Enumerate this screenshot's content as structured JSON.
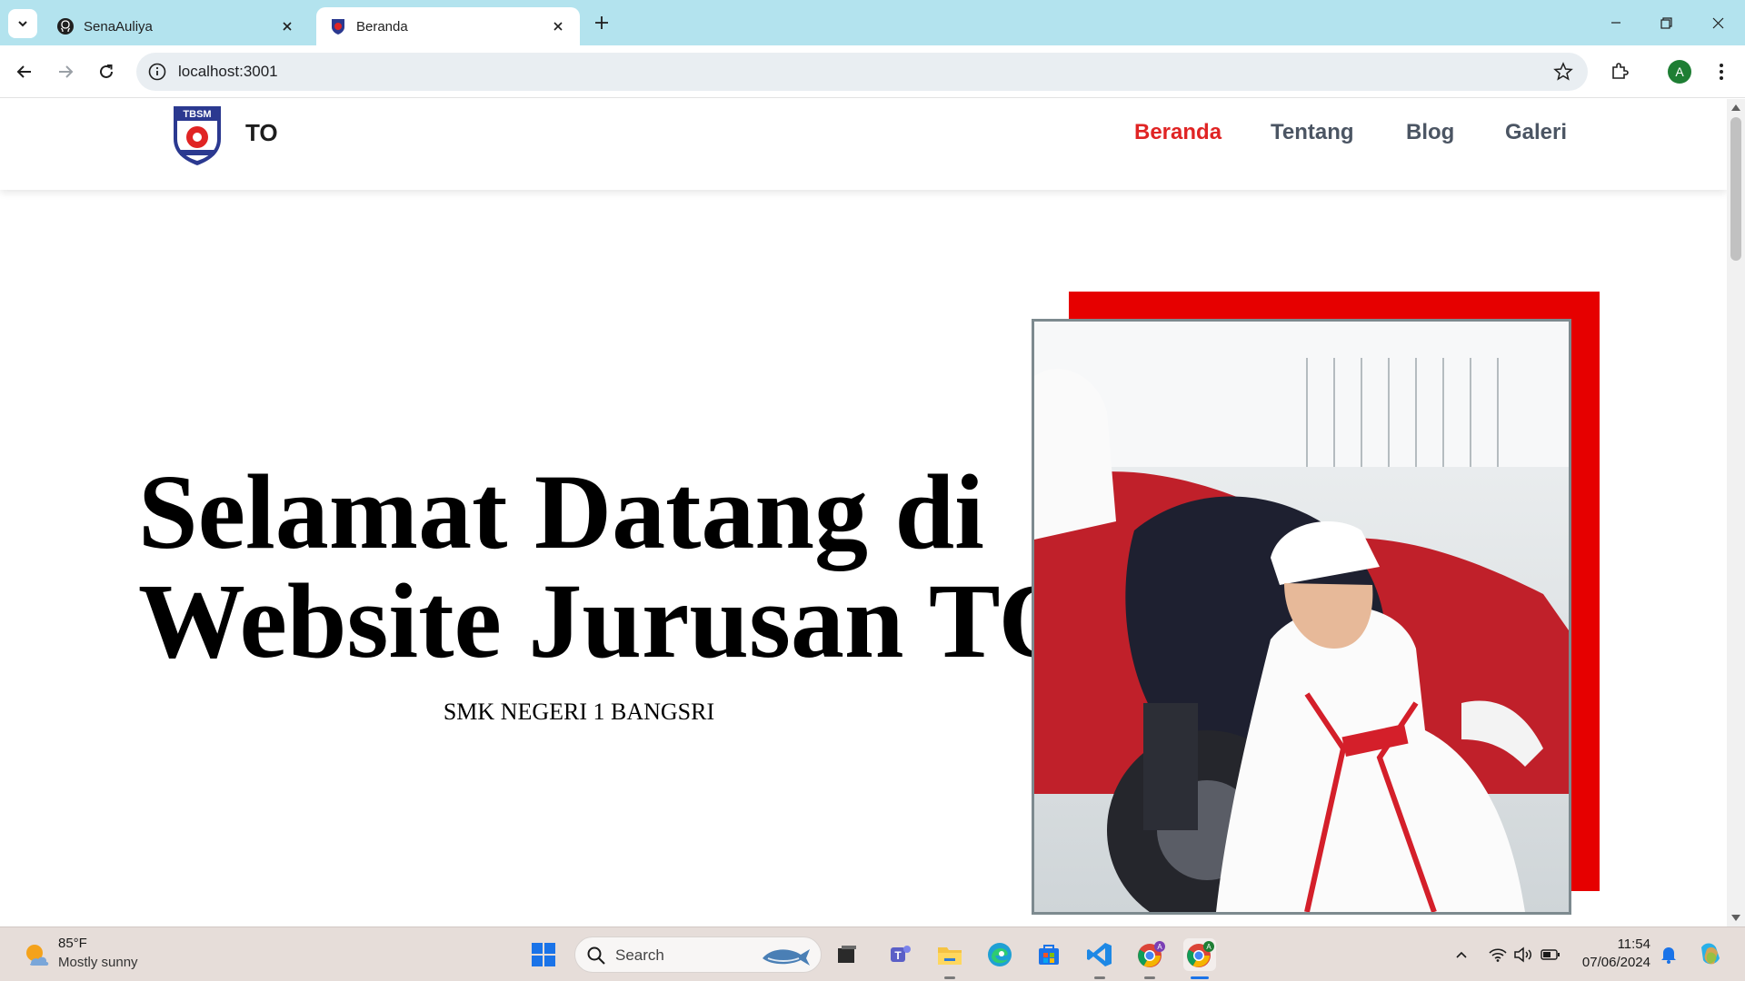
{
  "browser": {
    "tabs": [
      {
        "title": "SenaAuliya",
        "icon": "github-icon",
        "active": false
      },
      {
        "title": "Beranda",
        "icon": "tbsm-favicon",
        "active": true
      }
    ],
    "url": "localhost:3001",
    "profile_initial": "A"
  },
  "site": {
    "brand": "TO",
    "logo_text": "TBSM",
    "nav": [
      {
        "label": "Beranda",
        "active": true
      },
      {
        "label": "Tentang",
        "active": false
      },
      {
        "label": "Blog",
        "active": false
      },
      {
        "label": "Galeri",
        "active": false
      }
    ],
    "hero": {
      "title_line1": "Selamat Datang di",
      "title_line2": "Website Jurusan TO",
      "subtitle": "SMK NEGERI 1 BANGSRI"
    },
    "colors": {
      "accent": "#e02424",
      "frame": "#e60000",
      "nav_text": "#4b5563"
    }
  },
  "taskbar": {
    "weather": {
      "temp": "85°F",
      "condition": "Mostly sunny"
    },
    "search_placeholder": "Search",
    "time": "11:54",
    "date": "07/06/2024",
    "pinned": [
      "windows-start-icon",
      "task-view-icon",
      "teams-icon",
      "file-explorer-icon",
      "edge-icon",
      "store-icon",
      "vscode-icon",
      "chrome-icon",
      "chrome-icon"
    ]
  }
}
